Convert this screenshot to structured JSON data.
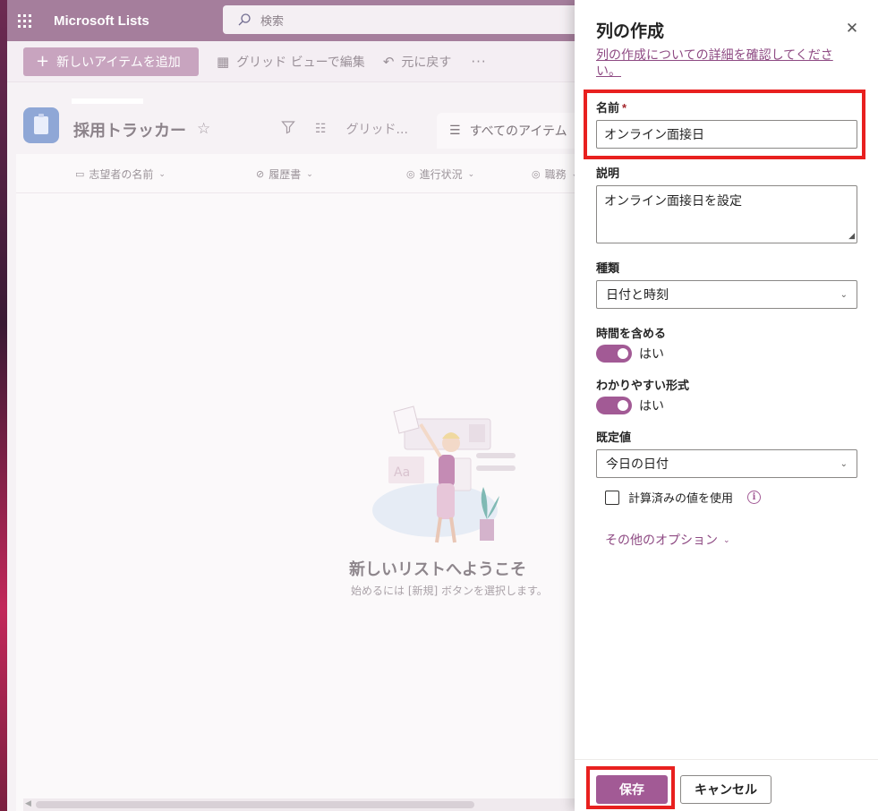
{
  "app": {
    "name": "Microsoft Lists",
    "search_placeholder": "検索"
  },
  "commandbar": {
    "new_item": "新しいアイテムを追加",
    "grid_edit": "グリッド ビューで編集",
    "undo": "元に戻す",
    "more": "···"
  },
  "list": {
    "title": "採用トラッカー",
    "view_grid": "グリッド...",
    "view_all": "すべてのアイテム"
  },
  "columns": [
    "志望者の名前",
    "履歴書",
    "進行状況",
    "職務"
  ],
  "empty_state": {
    "title": "新しいリストへようこそ",
    "subtitle": "始めるには [新規] ボタンを選択します。"
  },
  "panel": {
    "title": "列の作成",
    "learn_link": "列の作成についての詳細を確認してください。",
    "name_label": "名前",
    "required_mark": "*",
    "name_value": "オンライン面接日",
    "description_label": "説明",
    "description_value": "オンライン面接日を設定",
    "type_label": "種類",
    "type_value": "日付と時刻",
    "include_time_label": "時間を含める",
    "include_time_value": "はい",
    "friendly_format_label": "わかりやすい形式",
    "friendly_format_value": "はい",
    "default_label": "既定値",
    "default_value": "今日の日付",
    "calculated_label": "計算済みの値を使用",
    "more_options": "その他のオプション",
    "save": "保存",
    "cancel": "キャンセル"
  },
  "colors": {
    "accent": "#a25a95",
    "link": "#8e4a83",
    "highlight": "#e8201f"
  }
}
